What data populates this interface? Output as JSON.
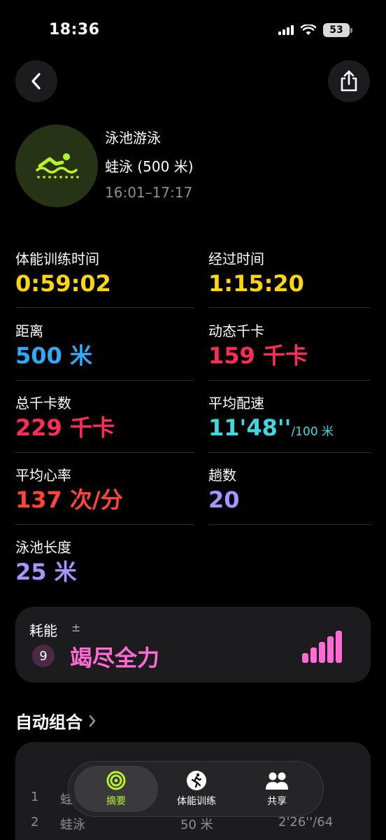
{
  "status_bar": {
    "time": "18:36",
    "battery": "53"
  },
  "icons": {
    "back": "chevron-left-icon",
    "share": "share-icon",
    "workout": "pool-swim-icon",
    "section_chevron": "chevron-right-icon"
  },
  "workout": {
    "title": "泳池游泳",
    "subtitle": "蛙泳 (500 米)",
    "time_range": "16:01–17:17"
  },
  "metrics": [
    {
      "label": "体能训练时间",
      "value": "0:59:02",
      "unit": "",
      "color": "#ffd60a"
    },
    {
      "label": "经过时间",
      "value": "1:15:20",
      "unit": "",
      "color": "#ffd60a"
    },
    {
      "label": "距离",
      "value": "500 米",
      "unit": "",
      "color": "#32a9f5"
    },
    {
      "label": "动态千卡",
      "value": "159 千卡",
      "unit": "",
      "color": "#ff2d55"
    },
    {
      "label": "总千卡数",
      "value": "229 千卡",
      "unit": "",
      "color": "#ff2d55"
    },
    {
      "label": "平均配速",
      "value": "11'48''",
      "unit": "/100 米",
      "color": "#40d8e0"
    },
    {
      "label": "平均心率",
      "value": "137 次/分",
      "unit": "",
      "color": "#ff453a"
    },
    {
      "label": "趟数",
      "value": "20",
      "unit": "",
      "color": "#a694ff"
    },
    {
      "label": "泳池长度",
      "value": "25 米",
      "unit": "",
      "color": "#a694ff"
    }
  ],
  "effort": {
    "label": "耗能",
    "plus_minus": "±",
    "level": "9",
    "value": "竭尽全力",
    "color": "#ff6ad5",
    "bars_filled": 5,
    "bars_total": 5
  },
  "auto_sets": {
    "title": "自动组合",
    "rows": [
      {
        "index": "1",
        "stroke": "蛙泳",
        "distance": "",
        "pace": ""
      },
      {
        "index": "2",
        "stroke": "蛙泳",
        "distance": "50 米",
        "pace": "2'26''/64"
      }
    ]
  },
  "tab_bar": {
    "tabs": [
      {
        "label": "摘要",
        "icon": "activity-rings-icon",
        "active": true
      },
      {
        "label": "体能训练",
        "icon": "running-figure-icon",
        "active": false
      },
      {
        "label": "共享",
        "icon": "people-icon",
        "active": false
      }
    ]
  }
}
